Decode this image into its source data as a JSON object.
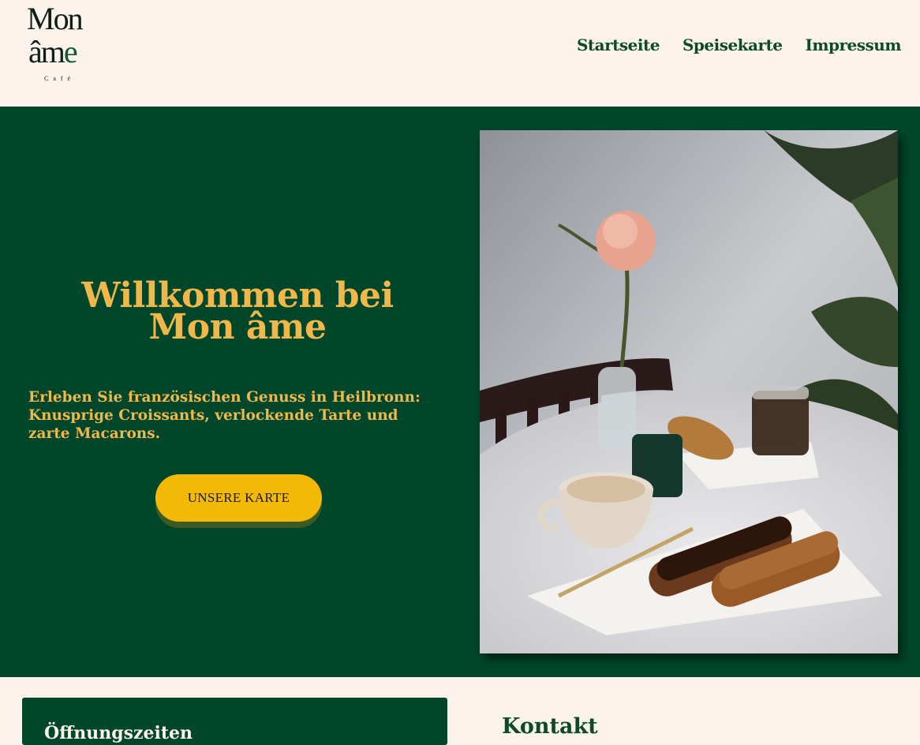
{
  "logo": {
    "line1": "Mon",
    "line2_a": "âm",
    "line2_b": "e",
    "line3": "Café"
  },
  "nav": {
    "items": [
      {
        "label": "Startseite"
      },
      {
        "label": "Speisekarte"
      },
      {
        "label": "Impressum"
      }
    ]
  },
  "hero": {
    "title_line1": "Willkommen bei",
    "title_line2": "Mon âme",
    "text": "Erleben Sie französischen Genuss in Heilbronn: Knusprige Croissants, verlockende Tarte und zarte Macarons.",
    "cta_label": "UNSERE KARTE"
  },
  "sections": {
    "hours_title": "Öffnungszeiten",
    "contact_title": "Kontakt"
  },
  "colors": {
    "background": "#fbf3ec",
    "brand_green": "#00462a",
    "accent_gold": "#f0b84a",
    "button_yellow": "#f4b906"
  }
}
